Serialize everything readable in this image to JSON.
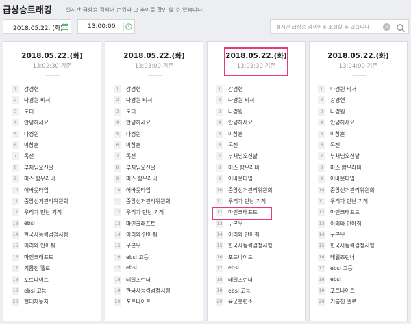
{
  "header": {
    "title": "급상승트래킹",
    "subtitle": "실시간 급상승 검색어 순위와 그 추이를 확인 할 수 있습니다."
  },
  "toolbar": {
    "date": "2018.05.22. (화)",
    "time": "13:00:00",
    "search_placeholder": "실시간 급상승 검색어를 조회할 수 있습니다",
    "search_value": "",
    "accent_color": "#57b86a"
  },
  "highlight_color": "#ea3a73",
  "columns": [
    {
      "date": "2018.05.22.(화)",
      "time": "13:02:30 기준",
      "items": [
        {
          "rank": "1",
          "keyword": "강경현"
        },
        {
          "rank": "2",
          "keyword": "나경원 비서"
        },
        {
          "rank": "3",
          "keyword": "도티"
        },
        {
          "rank": "4",
          "keyword": "안녕하세요"
        },
        {
          "rank": "5",
          "keyword": "나경원"
        },
        {
          "rank": "6",
          "keyword": "박창훈"
        },
        {
          "rank": "7",
          "keyword": "독전"
        },
        {
          "rank": "8",
          "keyword": "부처님오신날"
        },
        {
          "rank": "9",
          "keyword": "미스 함무라비"
        },
        {
          "rank": "10",
          "keyword": "어바웃타임"
        },
        {
          "rank": "11",
          "keyword": "중앙선거관리위원회"
        },
        {
          "rank": "12",
          "keyword": "우리가 만난 기적"
        },
        {
          "rank": "13",
          "keyword": "ebsi"
        },
        {
          "rank": "14",
          "keyword": "한국사능력검정시험"
        },
        {
          "rank": "15",
          "keyword": "이리와 안아줘"
        },
        {
          "rank": "16",
          "keyword": "마인크래프트"
        },
        {
          "rank": "17",
          "keyword": "기름진 멜로"
        },
        {
          "rank": "18",
          "keyword": "포트나이트"
        },
        {
          "rank": "19",
          "keyword": "ebsi 고등"
        },
        {
          "rank": "20",
          "keyword": "현대자동차"
        }
      ]
    },
    {
      "date": "2018.05.22.(화)",
      "time": "13:03:00 기준",
      "items": [
        {
          "rank": "1",
          "keyword": "강경현"
        },
        {
          "rank": "2",
          "keyword": "나경원 비서"
        },
        {
          "rank": "3",
          "keyword": "도티"
        },
        {
          "rank": "4",
          "keyword": "안녕하세요"
        },
        {
          "rank": "5",
          "keyword": "나경원"
        },
        {
          "rank": "6",
          "keyword": "박창훈"
        },
        {
          "rank": "7",
          "keyword": "독전"
        },
        {
          "rank": "8",
          "keyword": "부처님오신날"
        },
        {
          "rank": "9",
          "keyword": "미스 함무라비"
        },
        {
          "rank": "10",
          "keyword": "어바웃타임"
        },
        {
          "rank": "11",
          "keyword": "중앙선거관리위원회"
        },
        {
          "rank": "12",
          "keyword": "우리가 만난 기적"
        },
        {
          "rank": "13",
          "keyword": "마인크래프트"
        },
        {
          "rank": "14",
          "keyword": "이리와 안아줘"
        },
        {
          "rank": "15",
          "keyword": "구본무"
        },
        {
          "rank": "16",
          "keyword": "ebsi 고등"
        },
        {
          "rank": "17",
          "keyword": "ebsi"
        },
        {
          "rank": "18",
          "keyword": "테일즈런너"
        },
        {
          "rank": "19",
          "keyword": "한국사능력검정시험"
        },
        {
          "rank": "20",
          "keyword": "포트나이트"
        }
      ]
    },
    {
      "date": "2018.05.22.(화)",
      "time": "13:03:30 기준",
      "items": [
        {
          "rank": "1",
          "keyword": "강경현"
        },
        {
          "rank": "2",
          "keyword": "나경원 비서"
        },
        {
          "rank": "3",
          "keyword": "나경원"
        },
        {
          "rank": "4",
          "keyword": "안녕하세요"
        },
        {
          "rank": "5",
          "keyword": "박창훈"
        },
        {
          "rank": "6",
          "keyword": "독전"
        },
        {
          "rank": "7",
          "keyword": "부처님오신날"
        },
        {
          "rank": "8",
          "keyword": "미스 함무라비"
        },
        {
          "rank": "9",
          "keyword": "어바웃타임"
        },
        {
          "rank": "10",
          "keyword": "중앙선거관리위원회"
        },
        {
          "rank": "11",
          "keyword": "우리가 만난 기적"
        },
        {
          "rank": "12",
          "keyword": "마인크래프트"
        },
        {
          "rank": "13",
          "keyword": "구본무"
        },
        {
          "rank": "14",
          "keyword": "이리와 안아줘"
        },
        {
          "rank": "15",
          "keyword": "한국사능력검정시험"
        },
        {
          "rank": "16",
          "keyword": "포트나이트"
        },
        {
          "rank": "17",
          "keyword": "ebsi"
        },
        {
          "rank": "18",
          "keyword": "테일즈런너"
        },
        {
          "rank": "19",
          "keyword": "ebsi 고등"
        },
        {
          "rank": "20",
          "keyword": "육군훈련소"
        }
      ]
    },
    {
      "date": "2018.05.22.(화)",
      "time": "13:04:00 기준",
      "items": [
        {
          "rank": "1",
          "keyword": "나경원 비서"
        },
        {
          "rank": "2",
          "keyword": "강경현"
        },
        {
          "rank": "3",
          "keyword": "나경원"
        },
        {
          "rank": "4",
          "keyword": "안녕하세요"
        },
        {
          "rank": "5",
          "keyword": "박창훈"
        },
        {
          "rank": "6",
          "keyword": "독전"
        },
        {
          "rank": "7",
          "keyword": "부처님오신날"
        },
        {
          "rank": "8",
          "keyword": "미스 함무라비"
        },
        {
          "rank": "9",
          "keyword": "어바웃타임"
        },
        {
          "rank": "10",
          "keyword": "중앙선거관리위원회"
        },
        {
          "rank": "11",
          "keyword": "우리가 만난 기적"
        },
        {
          "rank": "12",
          "keyword": "마인크래프트"
        },
        {
          "rank": "13",
          "keyword": "이리와 안아줘"
        },
        {
          "rank": "14",
          "keyword": "구본무"
        },
        {
          "rank": "15",
          "keyword": "한국사능력검정시험"
        },
        {
          "rank": "16",
          "keyword": "테일즈런너"
        },
        {
          "rank": "17",
          "keyword": "ebsi 고등"
        },
        {
          "rank": "18",
          "keyword": "ebsi"
        },
        {
          "rank": "19",
          "keyword": "포트나이트"
        },
        {
          "rank": "20",
          "keyword": "기름진 멜로"
        }
      ]
    }
  ]
}
